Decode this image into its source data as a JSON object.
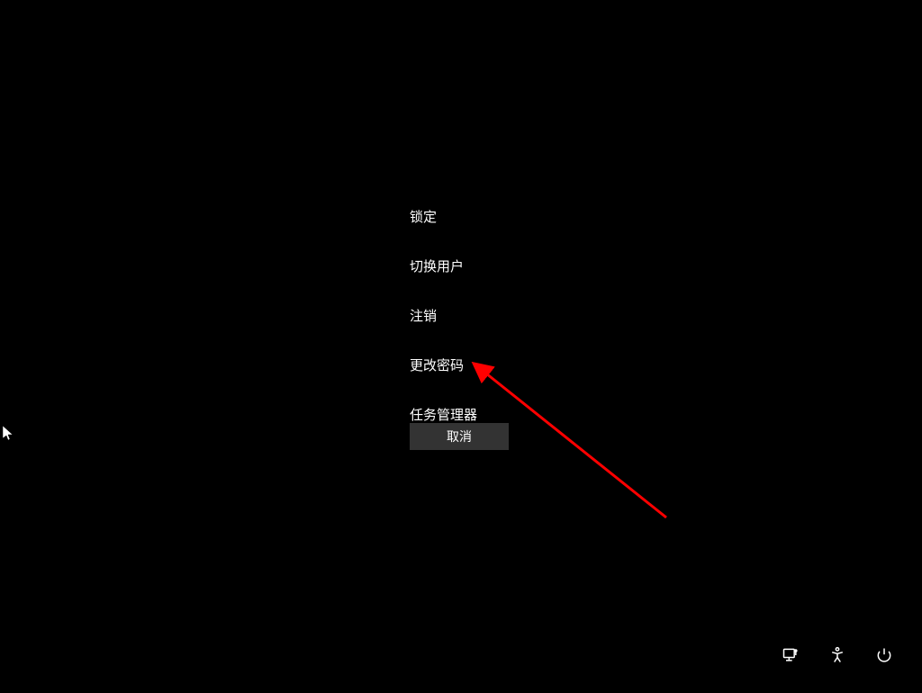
{
  "menu": {
    "items": [
      {
        "label": "锁定"
      },
      {
        "label": "切换用户"
      },
      {
        "label": "注销"
      },
      {
        "label": "更改密码"
      },
      {
        "label": "任务管理器"
      }
    ],
    "cancel_label": "取消"
  },
  "colors": {
    "background": "#000000",
    "text": "#ffffff",
    "button_bg": "#333333",
    "annotation": "#ff0000"
  }
}
